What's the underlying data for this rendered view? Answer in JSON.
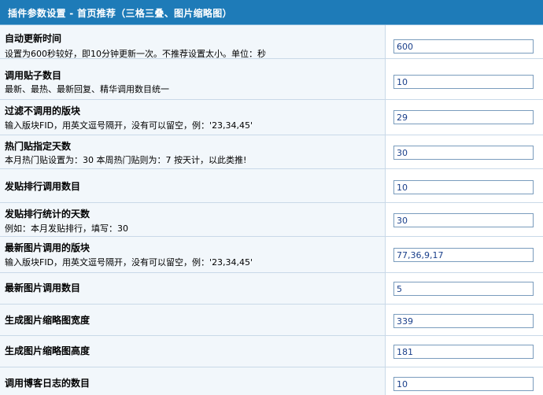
{
  "header": {
    "title": "插件参数设置 - 首页推荐（三格三叠、图片缩略图）"
  },
  "settings": [
    {
      "label": "自动更新时间",
      "desc": "设置为600秒较好，即10分钟更新一次。不推荐设置太小。单位：秒",
      "value": "600"
    },
    {
      "label": "调用贴子数目",
      "desc": "最新、最热、最新回复、精华调用数目统一",
      "value": "10"
    },
    {
      "label": "过滤不调用的版块",
      "desc": "输入版块FID，用英文逗号隔开，没有可以留空，例：'23,34,45'",
      "value": "29"
    },
    {
      "label": "热门贴指定天数",
      "desc": "本月热门贴设置为：30 本周热门贴则为：7 按天计，以此类推!",
      "value": "30"
    },
    {
      "label": "发贴排行调用数目",
      "desc": "",
      "value": "10"
    },
    {
      "label": "发贴排行统计的天数",
      "desc": "例如：本月发贴排行，填写：30",
      "value": "30"
    },
    {
      "label": "最新图片调用的版块",
      "desc": "输入版块FID，用英文逗号隔开，没有可以留空，例：'23,34,45'",
      "value": "77,36,9,17"
    },
    {
      "label": "最新图片调用数目",
      "desc": "",
      "value": "5"
    },
    {
      "label": "生成图片缩略图宽度",
      "desc": "",
      "value": "339"
    },
    {
      "label": "生成图片缩略图高度",
      "desc": "",
      "value": "181"
    },
    {
      "label": "调用博客日志的数目",
      "desc": "",
      "value": "10"
    }
  ]
}
